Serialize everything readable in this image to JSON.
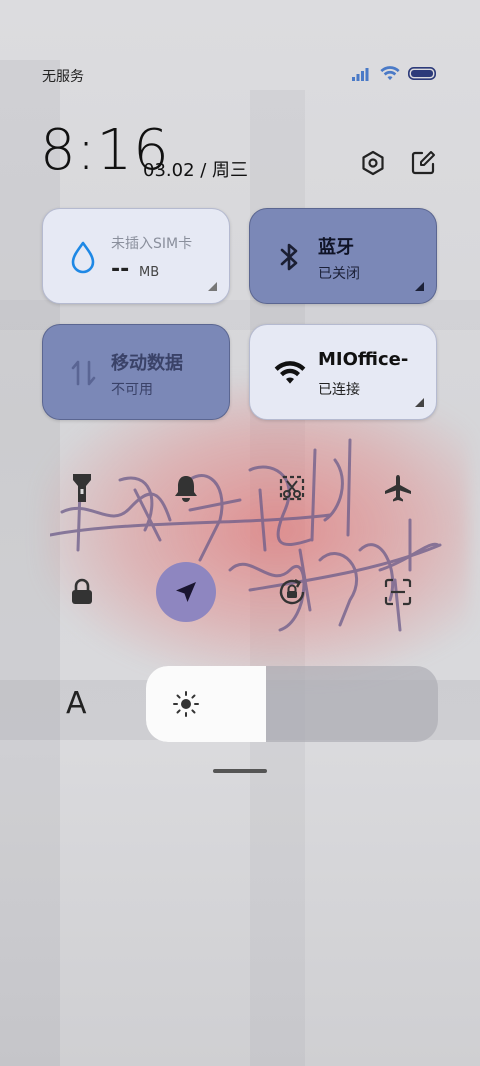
{
  "status_bar": {
    "carrier": "无服务",
    "icons": [
      "signal-icon",
      "wifi-icon",
      "battery-icon"
    ]
  },
  "header": {
    "time": "8:16",
    "date": "03.02 / 周三",
    "icons": [
      "settings-icon",
      "edit-icon"
    ]
  },
  "tiles": {
    "data_usage": {
      "title": "未插入SIM卡",
      "value": "--",
      "unit": "MB",
      "icon": "water-drop-icon"
    },
    "bluetooth": {
      "title": "蓝牙",
      "status": "已关闭",
      "icon": "bluetooth-icon"
    },
    "mobile_data": {
      "title": "移动数据",
      "status": "不可用",
      "icon": "data-arrows-icon"
    },
    "wifi": {
      "title": "MIOffice-",
      "status": "已连接",
      "icon": "wifi-icon"
    }
  },
  "quick_toggles": [
    {
      "name": "flashlight",
      "icon": "flashlight-icon"
    },
    {
      "name": "mute",
      "icon": "bell-icon"
    },
    {
      "name": "screenshot",
      "icon": "scissors-icon"
    },
    {
      "name": "airplane",
      "icon": "airplane-icon"
    },
    {
      "name": "lock",
      "icon": "lock-icon"
    },
    {
      "name": "location",
      "icon": "navigation-icon",
      "active": true
    },
    {
      "name": "rotation",
      "icon": "rotation-lock-icon"
    },
    {
      "name": "scan",
      "icon": "scan-icon"
    }
  ],
  "brightness": {
    "font_label": "A",
    "level": 0.41,
    "icon": "sun-icon"
  },
  "colors": {
    "tile_active": "#7b88b7",
    "tile_inactive": "#e6e9f4",
    "location_active": "#8e86c0",
    "accent_blue": "#1e88e5"
  }
}
